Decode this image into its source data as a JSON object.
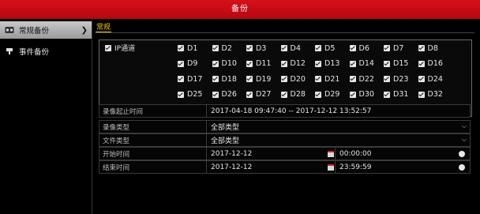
{
  "window": {
    "title": "备份"
  },
  "sidebar": {
    "items": [
      {
        "label": "常规备份",
        "icon": "tape-icon",
        "active": true
      },
      {
        "label": "事件备份",
        "icon": "pin-icon",
        "active": false
      }
    ]
  },
  "tabs": [
    {
      "label": "常规"
    }
  ],
  "channels": {
    "all_label": "IP通道",
    "all_checked": true,
    "rows": [
      [
        "D1",
        "D2",
        "D3",
        "D4",
        "D5",
        "D6",
        "D7",
        "D8"
      ],
      [
        "D9",
        "D10",
        "D11",
        "D12",
        "D13",
        "D14",
        "D15",
        "D16"
      ],
      [
        "D17",
        "D18",
        "D19",
        "D20",
        "D21",
        "D22",
        "D23",
        "D24"
      ],
      [
        "D25",
        "D26",
        "D27",
        "D28",
        "D29",
        "D30",
        "D31",
        "D32"
      ]
    ]
  },
  "form": {
    "record_range": {
      "label": "录像起止时间",
      "value": "2017-04-18 09:47:40 -- 2017-12-12 13:52:57"
    },
    "record_type": {
      "label": "录像类型",
      "value": "全部类型"
    },
    "file_type": {
      "label": "文件类型",
      "value": "全部类型"
    },
    "start": {
      "label": "开始时间",
      "date": "2017-12-12",
      "time": "00:00:00"
    },
    "end": {
      "label": "结束时间",
      "date": "2017-12-12",
      "time": "23:59:59"
    }
  },
  "colors": {
    "titlebar": "#c80c14",
    "tab_accent": "#f0c800"
  }
}
